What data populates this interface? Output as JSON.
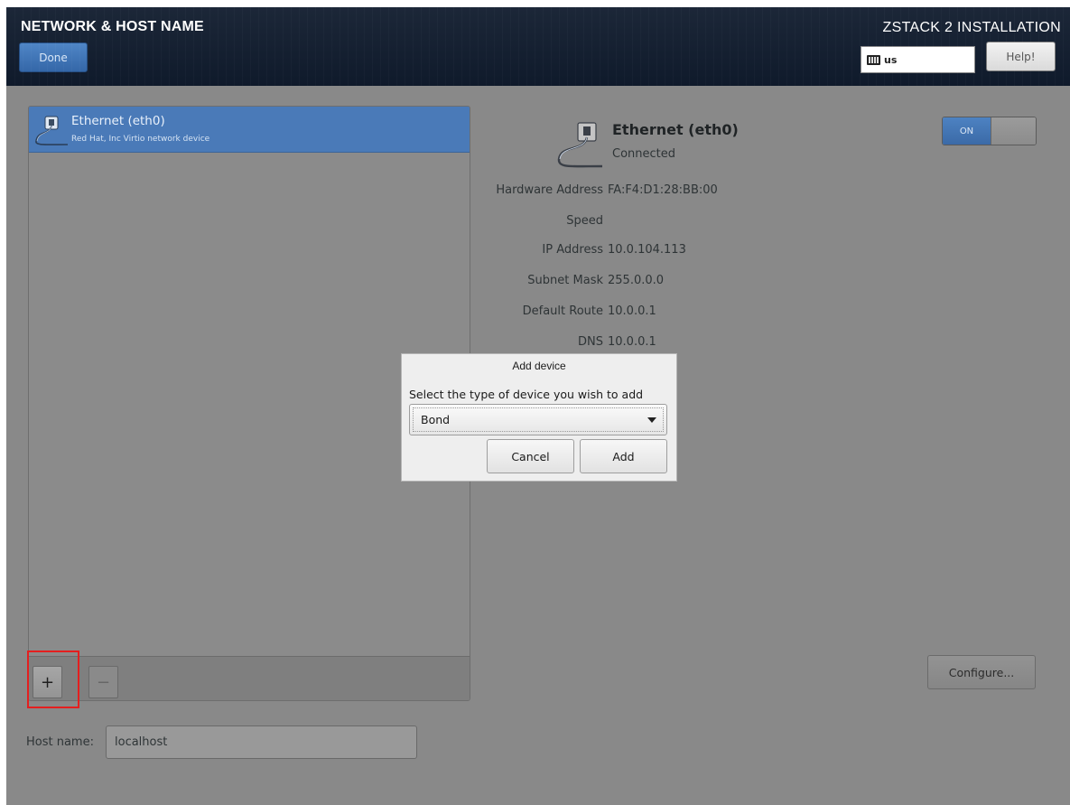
{
  "header": {
    "title": "NETWORK & HOST NAME",
    "product": "ZSTACK 2 INSTALLATION",
    "done_label": "Done",
    "keyboard_layout": "us",
    "help_label": "Help!"
  },
  "device_list": {
    "items": [
      {
        "name": "Ethernet (eth0)",
        "description": "Red Hat, Inc Virtio network device",
        "selected": true
      }
    ],
    "add_label": "+",
    "remove_label": "−"
  },
  "host": {
    "label": "Host name:",
    "value": "localhost"
  },
  "details": {
    "name": "Ethernet (eth0)",
    "status": "Connected",
    "toggle_label": "ON",
    "toggle_state": "on",
    "fields": [
      {
        "label": "Hardware Address",
        "value": "FA:F4:D1:28:BB:00"
      },
      {
        "label": "Speed",
        "value": ""
      },
      {
        "label": "IP Address",
        "value": "10.0.104.113"
      },
      {
        "label": "Subnet Mask",
        "value": "255.0.0.0"
      },
      {
        "label": "Default Route",
        "value": "10.0.0.1"
      },
      {
        "label": "DNS",
        "value": "10.0.0.1"
      }
    ],
    "configure_label": "Configure..."
  },
  "dialog": {
    "title": "Add device",
    "prompt": "Select the type of device you wish to add",
    "selected_type": "Bond",
    "cancel_label": "Cancel",
    "add_label": "Add"
  },
  "colors": {
    "header_bg": "#111c2d",
    "accent_blue": "#4a7ab8",
    "panel_gray": "#898989",
    "highlight_red": "#e41f1f"
  }
}
